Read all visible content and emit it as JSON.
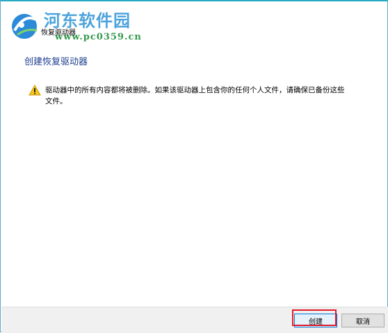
{
  "window": {
    "title": "恢复驱动器"
  },
  "watermark": {
    "site_name": "河东软件园",
    "url": "www.pc0359.cn"
  },
  "page": {
    "heading": "创建恢复驱动器",
    "warning_text": "驱动器中的所有内容都将被删除。如果该驱动器上包含你的任何个人文件，请确保已备份这些文件。"
  },
  "footer": {
    "create_label": "创建",
    "cancel_label": "取消"
  },
  "colors": {
    "accent": "#23a9c1",
    "heading": "#1c3d8e",
    "highlight": "#e01a2a"
  }
}
